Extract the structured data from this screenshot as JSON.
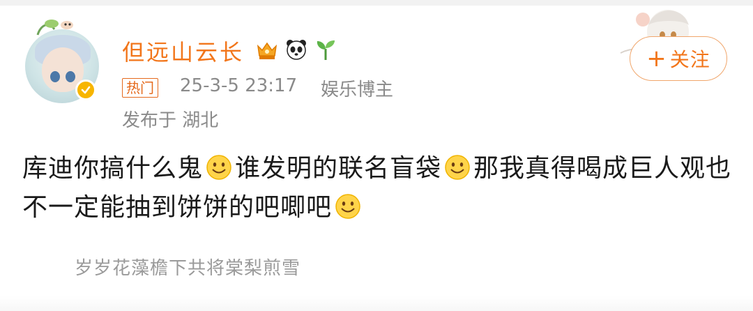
{
  "post": {
    "author": "但远山云长",
    "hot_tag": "热门",
    "timestamp": "25-3-5 23:17",
    "role": "娱乐博主",
    "location": "发布于 湖北",
    "follow_label": "关注",
    "follow_plus": "+",
    "content_segments": [
      "库迪你搞什么鬼",
      "谁发明的联名盲袋",
      "那我真得喝成巨人观也不一定能抽到饼饼的吧唧吧"
    ],
    "emoji_name": "smile-emoji",
    "emblem_icons": [
      "crown-badge-icon",
      "panda-icon",
      "sprout-icon"
    ],
    "verified_badge_icon": "verified-badge-icon",
    "caption": "岁岁花藻檐下共将棠梨煎雪"
  },
  "colors": {
    "accent": "#f2761b",
    "meta_text": "#8a8a8a",
    "body_text": "#1a1a1a",
    "verified": "#f7b500"
  }
}
